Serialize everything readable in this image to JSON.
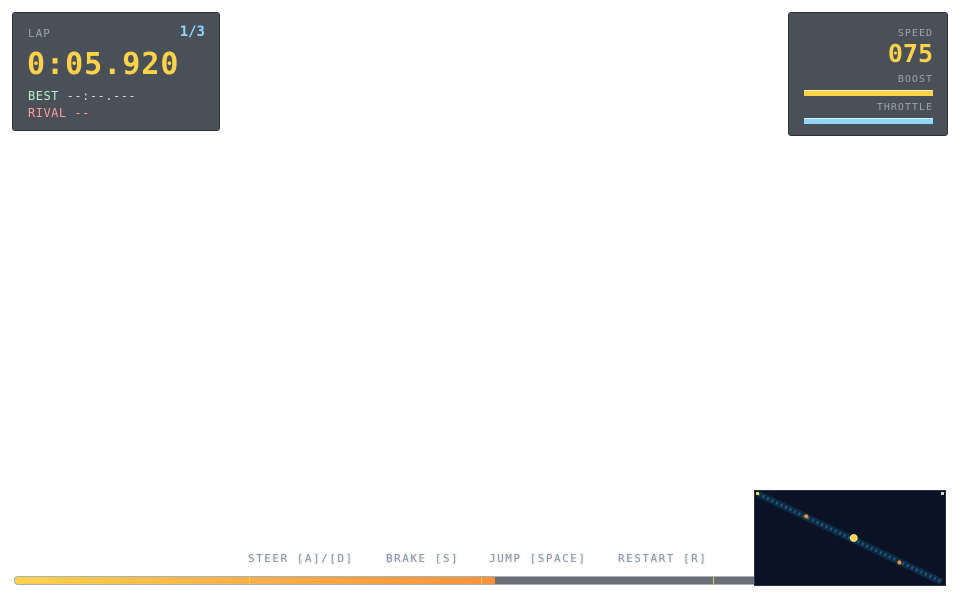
{
  "hud": {
    "lap": {
      "label": "LAP",
      "count": "1/3",
      "time": "0:05.920",
      "best_key": "BEST",
      "best_value": "--:--.---",
      "rival_key": "RIVAL",
      "rival_value": "--"
    },
    "speed": {
      "label": "SPEED",
      "value": "075",
      "boost_label": "BOOST",
      "boost_level": 1.0,
      "throttle_label": "THROTTLE",
      "throttle_level": 1.0
    }
  },
  "controls": {
    "steer": "STEER [A]/[D]",
    "brake": "BRAKE [S]",
    "jump": "JUMP [SPACE]",
    "restart": "RESTART [R]"
  },
  "track_progress": {
    "fraction": 0.65,
    "checkpoints": [
      0.317,
      0.63,
      0.945
    ]
  },
  "minimap": {
    "player_position": [
      0.52,
      0.5
    ],
    "markers": [
      [
        0.27,
        0.27
      ],
      [
        0.76,
        0.76
      ]
    ],
    "colors": {
      "background": "#0b1226",
      "track": "#1e5a7a",
      "player": "#ffd24a",
      "marker": "#f9913b"
    }
  },
  "colors": {
    "accent": "#ffd24a",
    "lap_count": "#8fd6ff",
    "panel": "#4a5058",
    "rival": "#ff9a9a",
    "best": "#b8f0c8",
    "progress_fill_start": "#ffd24a",
    "progress_fill_end": "#f9913b"
  }
}
